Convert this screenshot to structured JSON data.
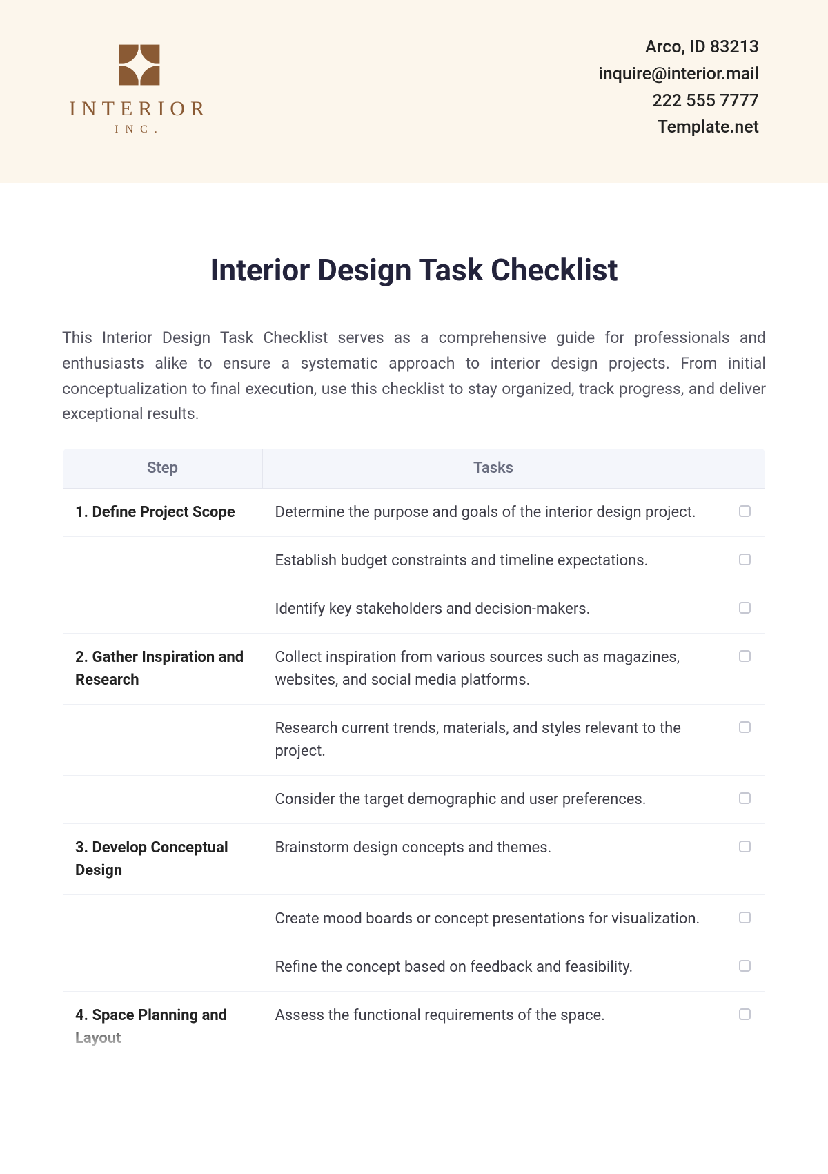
{
  "header": {
    "logo": {
      "word": "INTERIOR",
      "sub": "INC."
    },
    "contact": {
      "address": "Arco, ID 83213",
      "email": "inquire@interior.mail",
      "phone": "222 555 7777",
      "site": "Template.net"
    }
  },
  "title": "Interior Design Task Checklist",
  "intro": "This Interior Design Task Checklist serves as a comprehensive guide for professionals and enthusiasts alike to ensure a systematic approach to interior design projects. From initial conceptualization to final execution, use this checklist to stay organized, track progress, and deliver exceptional results.",
  "table": {
    "headers": {
      "step": "Step",
      "tasks": "Tasks",
      "check": ""
    },
    "rows": [
      {
        "step": "1. Define Project Scope",
        "task": "Determine the purpose and goals of the interior design project."
      },
      {
        "step": "",
        "task": "Establish budget constraints and timeline expectations."
      },
      {
        "step": "",
        "task": "Identify key stakeholders and decision-makers."
      },
      {
        "step": "2. Gather Inspiration and Research",
        "task": "Collect inspiration from various sources such as magazines, websites, and social media platforms."
      },
      {
        "step": "",
        "task": "Research current trends, materials, and styles relevant to the project."
      },
      {
        "step": "",
        "task": "Consider the target demographic and user preferences."
      },
      {
        "step": "3. Develop Conceptual Design",
        "task": "Brainstorm design concepts and themes."
      },
      {
        "step": "",
        "task": "Create mood boards or concept presentations for visualization."
      },
      {
        "step": "",
        "task": "Refine the concept based on feedback and feasibility."
      },
      {
        "step": "4. Space Planning and Layout",
        "task": "Assess the functional requirements of the space."
      }
    ]
  }
}
